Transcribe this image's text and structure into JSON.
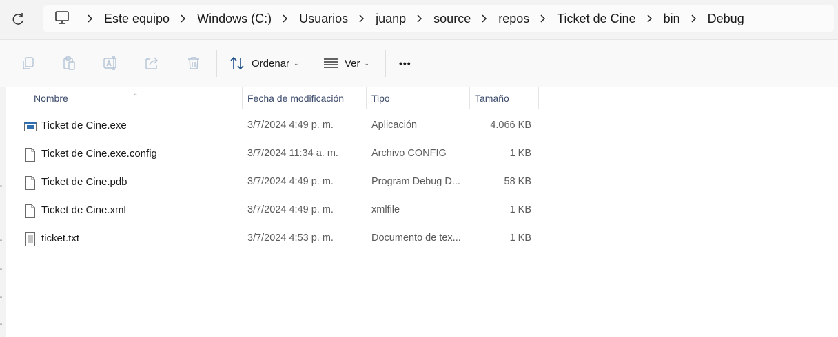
{
  "address": {
    "crumbs": [
      "Este equipo",
      "Windows (C:)",
      "Usuarios",
      "juanp",
      "source",
      "repos",
      "Ticket de Cine",
      "bin",
      "Debug"
    ]
  },
  "toolbar": {
    "sort_label": "Ordenar",
    "view_label": "Ver",
    "more_label": "•••"
  },
  "columns": {
    "name": "Nombre",
    "date": "Fecha de modificación",
    "type": "Tipo",
    "size": "Tamaño"
  },
  "files": [
    {
      "name": "Ticket de Cine.exe",
      "date": "3/7/2024 4:49 p. m.",
      "type": "Aplicación",
      "size": "4.066 KB",
      "icon": "exe-icon"
    },
    {
      "name": "Ticket de Cine.exe.config",
      "date": "3/7/2024 11:34 a. m.",
      "type": "Archivo CONFIG",
      "size": "1 KB",
      "icon": "file-icon"
    },
    {
      "name": "Ticket de Cine.pdb",
      "date": "3/7/2024 4:49 p. m.",
      "type": "Program Debug D...",
      "size": "58 KB",
      "icon": "file-icon"
    },
    {
      "name": "Ticket de Cine.xml",
      "date": "3/7/2024 4:49 p. m.",
      "type": "xmlfile",
      "size": "1 KB",
      "icon": "file-icon"
    },
    {
      "name": "ticket.txt",
      "date": "3/7/2024 4:53 p. m.",
      "type": "Documento de tex...",
      "size": "1 KB",
      "icon": "text-file-icon"
    }
  ],
  "colors": {
    "accent": "#0067c0",
    "header_text": "#3b4a6b"
  }
}
